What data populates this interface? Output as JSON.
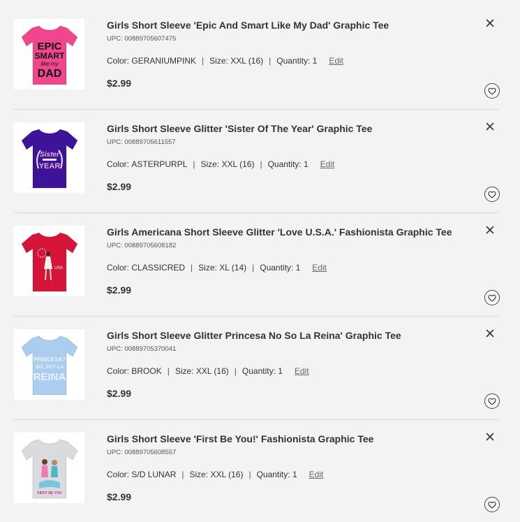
{
  "labels": {
    "color": "Color:",
    "size": "Size:",
    "quantity": "Quantity:",
    "edit": "Edit",
    "upc": "UPC:",
    "separator": "|"
  },
  "icons": {
    "remove": "close-icon",
    "wishlist": "heart-icon"
  },
  "items": [
    {
      "title": "Girls Short Sleeve 'Epic And Smart Like My Dad' Graphic Tee",
      "upc": "00889705607475",
      "color": "GERANIUMPINK",
      "size": "XXL (16)",
      "quantity": "1",
      "price": "$2.99",
      "shirt_color": "#f0468e",
      "print": [
        "EPIC",
        "SMART",
        "like my",
        "DAD"
      ]
    },
    {
      "title": "Girls Short Sleeve Glitter 'Sister Of The Year' Graphic Tee",
      "upc": "00889705611557",
      "color": "ASTERPURPL",
      "size": "XXL (16)",
      "quantity": "1",
      "price": "$2.99",
      "shirt_color": "#3d1399",
      "print": [
        "Sister",
        "YEAR"
      ]
    },
    {
      "title": "Girls Americana Short Sleeve Glitter 'Love U.S.A.' Fashionista Graphic Tee",
      "upc": "00889705608182",
      "color": "CLASSICRED",
      "size": "XL (14)",
      "quantity": "1",
      "price": "$2.99",
      "shirt_color": "#d6143a",
      "print": [
        "USA"
      ]
    },
    {
      "title": "Girls Short Sleeve Glitter Princesa No So La Reina' Graphic Tee",
      "upc": "00889705370041",
      "color": "BROOK",
      "size": "XXL (16)",
      "quantity": "1",
      "price": "$2.99",
      "shirt_color": "#aacdf0",
      "print": [
        "PRINCESA?",
        "NO, SOY LA",
        "REINA"
      ]
    },
    {
      "title": "Girls Short Sleeve 'First Be You!' Fashionista Graphic Tee",
      "upc": "00889705608557",
      "color": "S/D LUNAR",
      "size": "XXL (16)",
      "quantity": "1",
      "price": "$2.99",
      "shirt_color": "#d9dbdf",
      "print": [
        "FIRST BE YOU"
      ]
    }
  ]
}
